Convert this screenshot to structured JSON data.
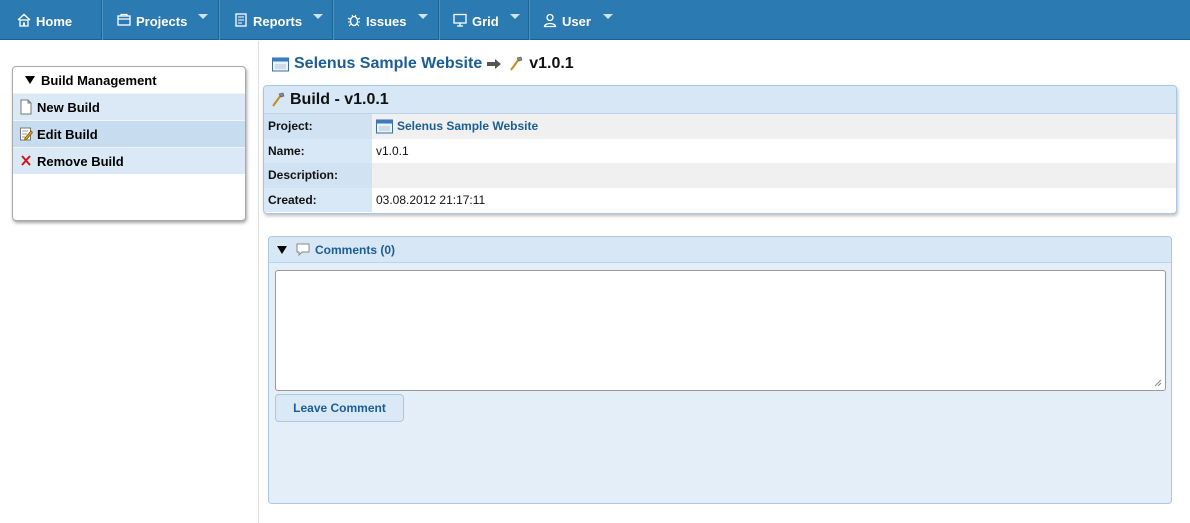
{
  "nav": {
    "home": {
      "label": "Home",
      "icon": "home-icon"
    },
    "projects": {
      "label": "Projects",
      "icon": "projects-icon"
    },
    "reports": {
      "label": "Reports",
      "icon": "reports-icon"
    },
    "issues": {
      "label": "Issues",
      "icon": "bug-icon"
    },
    "grid": {
      "label": "Grid",
      "icon": "monitor-icon"
    },
    "user": {
      "label": "User",
      "icon": "user-icon"
    }
  },
  "sidebar": {
    "title": "Build Management",
    "items": [
      {
        "label": "New Build",
        "icon": "document-icon"
      },
      {
        "label": "Edit Build",
        "icon": "edit-icon"
      },
      {
        "label": "Remove Build",
        "icon": "remove-x-icon"
      }
    ]
  },
  "breadcrumb": {
    "project": "Selenus Sample Website",
    "current": "v1.0.1"
  },
  "build": {
    "title": "Build - v1.0.1",
    "fields": [
      {
        "label": "Project:",
        "value": "Selenus Sample Website"
      },
      {
        "label": "Name:",
        "value": "v1.0.1"
      },
      {
        "label": "Description:",
        "value": ""
      },
      {
        "label": "Created:",
        "value": "03.08.2012 21:17:11"
      }
    ]
  },
  "comments": {
    "title": "Comments (0)",
    "textarea_value": "",
    "button_label": "Leave Comment"
  },
  "colors": {
    "nav_bg": "#2b7ab1",
    "link": "#1b5d95",
    "panel_header": "#d7e7f5"
  }
}
